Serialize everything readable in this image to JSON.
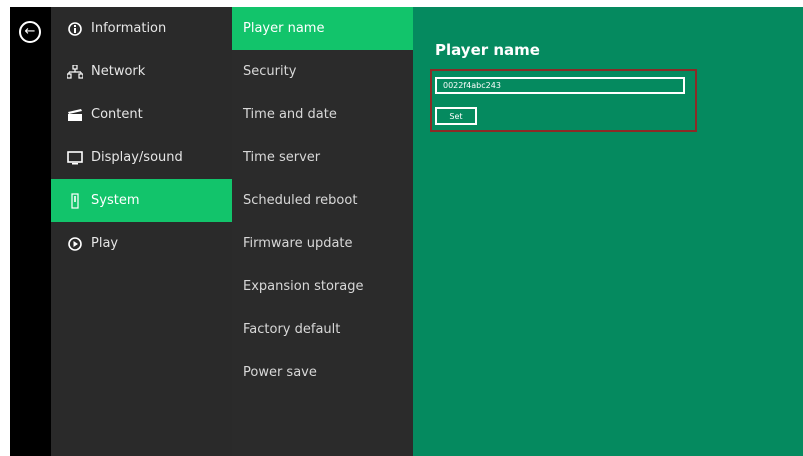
{
  "nav": {
    "items": [
      {
        "label": "Information",
        "icon": "info-icon"
      },
      {
        "label": "Network",
        "icon": "network-icon"
      },
      {
        "label": "Content",
        "icon": "clapperboard-icon"
      },
      {
        "label": "Display/sound",
        "icon": "monitor-icon"
      },
      {
        "label": "System",
        "icon": "system-icon",
        "active": true
      },
      {
        "label": "Play",
        "icon": "play-icon"
      }
    ]
  },
  "submenu": {
    "items": [
      {
        "label": "Player name",
        "active": true
      },
      {
        "label": "Security"
      },
      {
        "label": "Time and date"
      },
      {
        "label": "Time server"
      },
      {
        "label": "Scheduled reboot"
      },
      {
        "label": "Firmware update"
      },
      {
        "label": "Expansion storage"
      },
      {
        "label": "Factory default"
      },
      {
        "label": "Power save"
      }
    ]
  },
  "content": {
    "title": "Player name",
    "player_name_value": "0022f4abc243",
    "set_label": "Set"
  },
  "colors": {
    "accent": "#12c46b",
    "content_bg": "#058a5f",
    "highlight": "#8b2a26"
  }
}
